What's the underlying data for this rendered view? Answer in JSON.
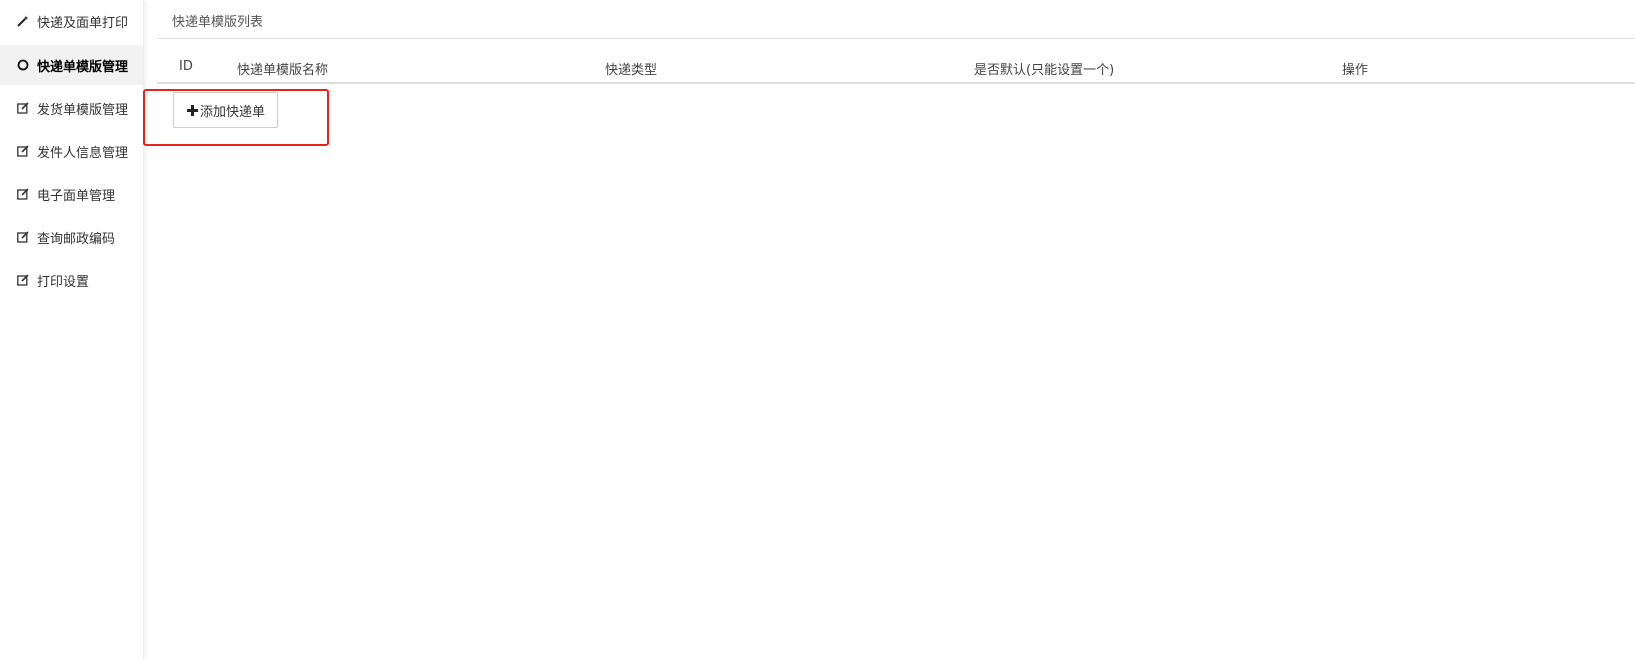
{
  "sidebar": {
    "items": [
      {
        "label": "快递及面单打印",
        "icon": "magic-wand-icon"
      },
      {
        "label": "快递单模版管理",
        "icon": "circle-icon",
        "active": true
      },
      {
        "label": "发货单模版管理",
        "icon": "edit-icon"
      },
      {
        "label": "发件人信息管理",
        "icon": "edit-icon"
      },
      {
        "label": "电子面单管理",
        "icon": "edit-icon"
      },
      {
        "label": "查询邮政编码",
        "icon": "edit-icon"
      },
      {
        "label": "打印设置",
        "icon": "edit-icon"
      }
    ]
  },
  "main": {
    "title": "快递单模版列表",
    "table": {
      "columns": [
        "ID",
        "快递单模版名称",
        "快递类型",
        "是否默认(只能设置一个)",
        "操作"
      ],
      "rows": []
    },
    "add_button": {
      "label": "添加快递单",
      "icon": "plus-icon"
    }
  },
  "colors": {
    "highlight": "#e8231b",
    "active_bg": "#f2f2f2"
  }
}
